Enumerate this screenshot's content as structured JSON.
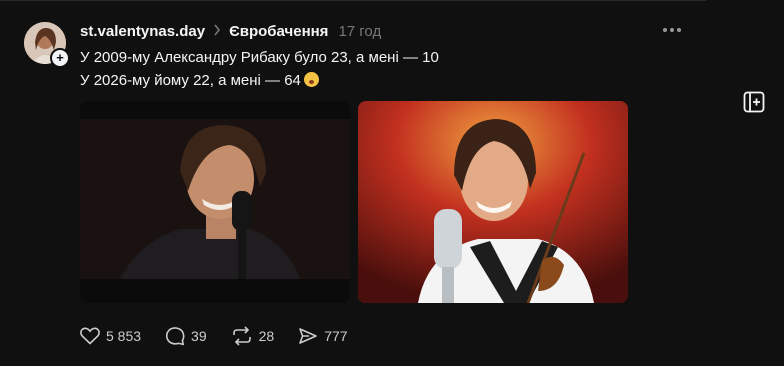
{
  "post": {
    "username": "st.valentynas.day",
    "topic": "Євробачення",
    "time": "17 год",
    "line1": "У 2009-му Александру Рибаку було 23, а мені — 10",
    "line2": "У 2026-му йому 22, а мені — 64",
    "emoji": "flushed-face-emoji",
    "images": [
      {
        "alt_icon": "photo-singer-microphone"
      },
      {
        "alt_icon": "photo-singer-violin-trophy"
      }
    ]
  },
  "actions": {
    "likes": "5 853",
    "comments": "39",
    "reposts": "28",
    "shares": "777"
  },
  "colors": {
    "background": "#101010",
    "text": "#f3f5f7",
    "muted": "#777777"
  }
}
